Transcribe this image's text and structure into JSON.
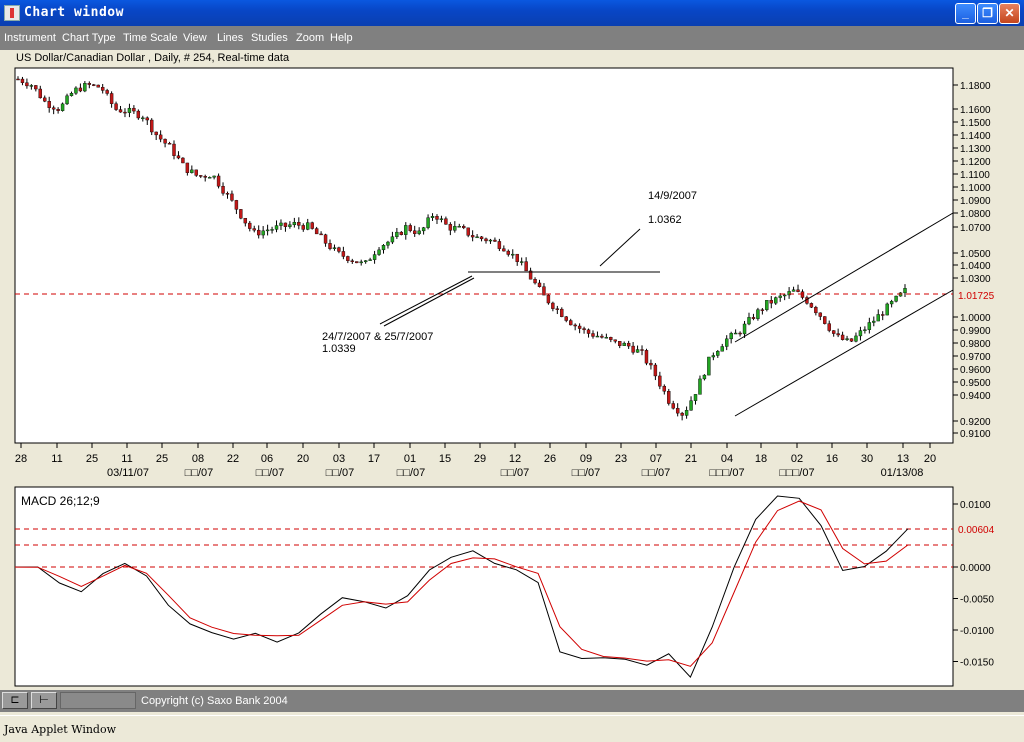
{
  "window": {
    "title": "Chart window",
    "icon": "java-cup-icon",
    "controls": [
      "minimize",
      "restore",
      "close"
    ]
  },
  "menu": [
    "Instrument",
    "Chart Type",
    "Time Scale",
    "View",
    "Lines",
    "Studies",
    "Zoom",
    "Help"
  ],
  "chart_info": "US Dollar/Canadian Dollar , Daily, # 254, Real-time data",
  "chart_data": [
    {
      "type": "candlestick",
      "instrument": "US Dollar/Canadian Dollar",
      "title": "",
      "price_ticks": [
        "1.1800",
        "1.1600",
        "1.1500",
        "1.1400",
        "1.1300",
        "1.1200",
        "1.1100",
        "1.1000",
        "1.0900",
        "1.0800",
        "1.0700",
        "1.0500",
        "1.0400",
        "1.0300",
        "1.0000",
        "0.9900",
        "0.9800",
        "0.9700",
        "0.9600",
        "0.9500",
        "0.9400",
        "0.9200",
        "0.9100"
      ],
      "current_price": "1.01725",
      "date_ticks": [
        "28",
        "11",
        "25",
        "11",
        "25",
        "08",
        "22",
        "06",
        "20",
        "03",
        "17",
        "01",
        "15",
        "29",
        "12",
        "26",
        "09",
        "23",
        "07",
        "21",
        "04",
        "18",
        "02",
        "16",
        "30",
        "13",
        "20"
      ],
      "month_labels": [
        "03/11/07",
        "□□/07",
        "□□/07",
        "□□/07",
        "□□/07",
        "□□/07",
        "□□/07",
        "□□/07",
        "□□□/07",
        "□□□/07",
        "01/13/08"
      ],
      "annotations": [
        {
          "date": "24/7/2007 & 25/7/2007",
          "price": "1.0339"
        },
        {
          "date": "14/9/2007",
          "price": "1.0362"
        }
      ],
      "close_path": [
        1.185,
        1.18,
        1.165,
        1.16,
        1.175,
        1.18,
        1.178,
        1.16,
        1.158,
        1.155,
        1.14,
        1.13,
        1.115,
        1.108,
        1.11,
        1.095,
        1.08,
        1.065,
        1.068,
        1.07,
        1.072,
        1.07,
        1.06,
        1.05,
        1.045,
        1.04,
        1.055,
        1.06,
        1.07,
        1.065,
        1.08,
        1.07,
        1.068,
        1.062,
        1.06,
        1.055,
        1.045,
        1.03,
        1.015,
        1.005,
        0.995,
        0.988,
        0.985,
        0.98,
        0.978,
        0.972,
        0.955,
        0.935,
        0.925,
        0.945,
        0.97,
        0.982,
        0.988,
        1.0,
        1.01,
        1.015,
        1.02,
        1.012,
        1.0,
        0.985,
        0.98,
        0.99,
        1.0,
        1.01,
        1.02
      ]
    },
    {
      "type": "line",
      "title": "MACD 26;12;9",
      "y_ticks": [
        "0.0100",
        "0.0000",
        "-0.0050",
        "-0.0100",
        "-0.0150"
      ],
      "current_value": "0.00604",
      "ylim": [
        -0.0175,
        0.0125
      ],
      "macd": [
        0.0,
        0.0,
        -0.0025,
        -0.004,
        -0.001,
        0.0005,
        -0.0015,
        -0.006,
        -0.009,
        -0.0105,
        -0.0115,
        -0.0105,
        -0.012,
        -0.0105,
        -0.0075,
        -0.0048,
        -0.0055,
        -0.0065,
        -0.0045,
        -0.0005,
        0.0015,
        0.0025,
        0.0005,
        -0.0005,
        -0.0025,
        -0.0135,
        -0.0145,
        -0.0145,
        -0.0147,
        -0.0155,
        -0.0138,
        -0.0175,
        -0.0095,
        0.0,
        0.0075,
        0.0112,
        0.011,
        0.0065,
        -0.0005,
        0.0,
        0.0025,
        0.006
      ],
      "signal": [
        0.0,
        0.0,
        -0.0015,
        -0.003,
        -0.0015,
        0.0002,
        -0.001,
        -0.0045,
        -0.008,
        -0.0095,
        -0.0105,
        -0.0108,
        -0.011,
        -0.0108,
        -0.0085,
        -0.006,
        -0.0055,
        -0.0058,
        -0.0055,
        -0.002,
        0.0005,
        0.0015,
        0.0012,
        0.0,
        -0.001,
        -0.0095,
        -0.013,
        -0.0142,
        -0.0145,
        -0.015,
        -0.0148,
        -0.0158,
        -0.012,
        -0.004,
        0.004,
        0.009,
        0.0105,
        0.009,
        0.003,
        0.0005,
        0.001,
        0.0035
      ]
    }
  ],
  "status": {
    "copyright": "Copyright (c) Saxo Bank 2004",
    "buttons": [
      "⊏",
      "⊢"
    ]
  },
  "applet": "Java Applet Window"
}
